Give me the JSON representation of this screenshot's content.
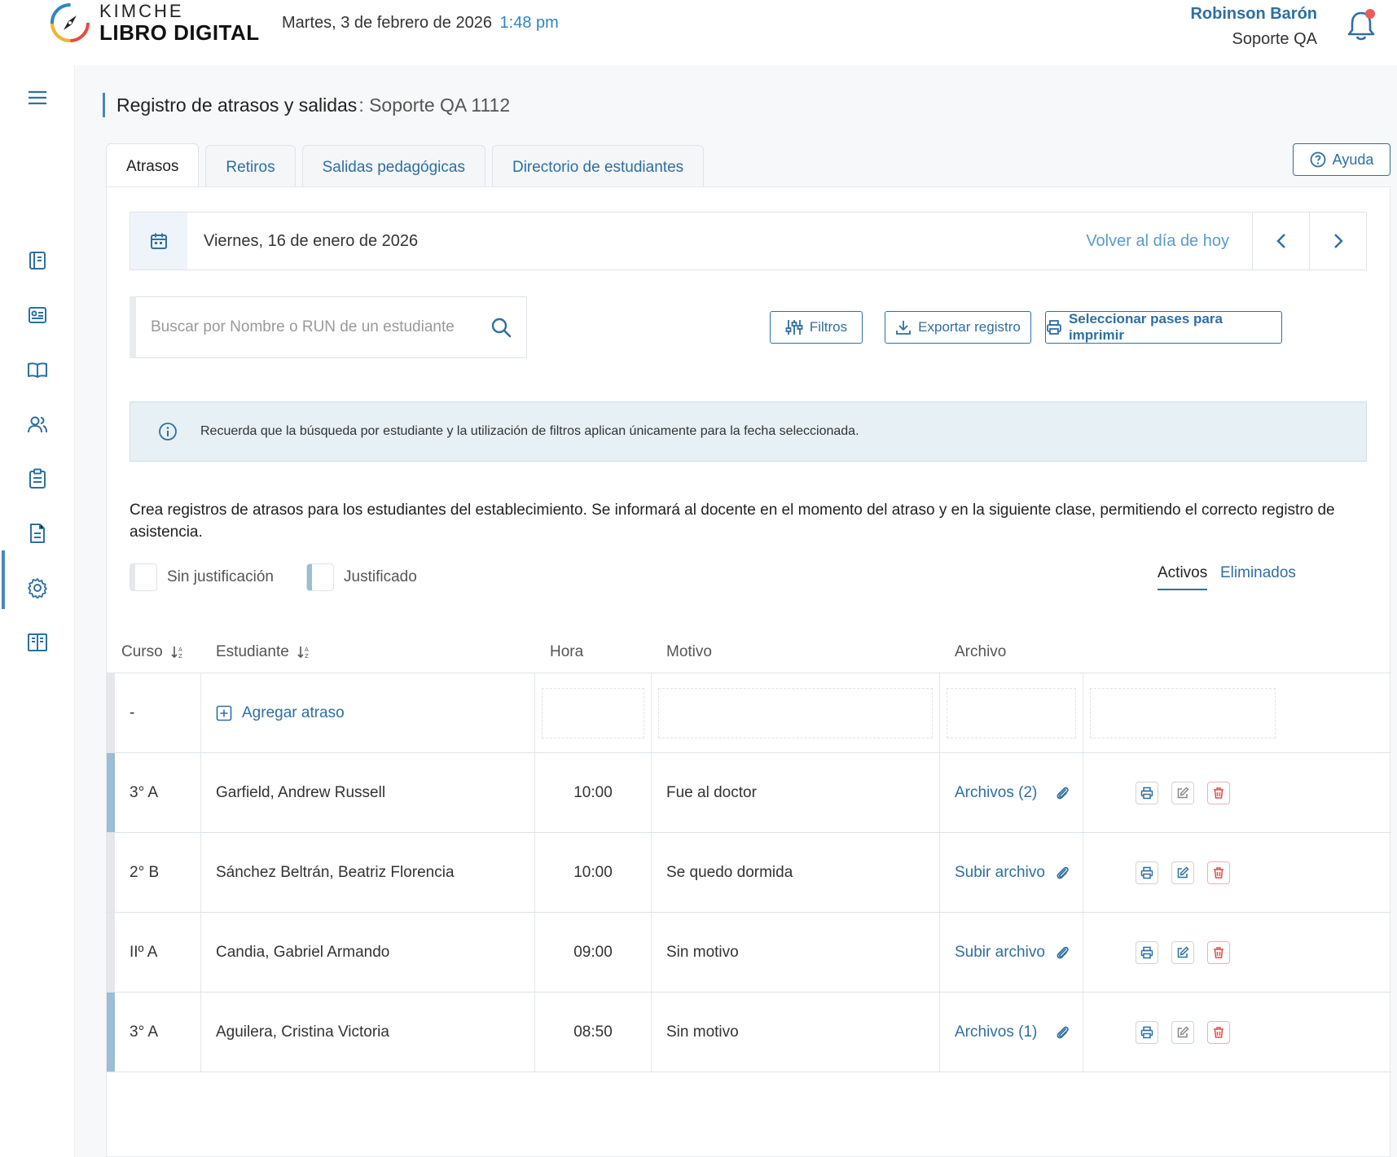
{
  "header": {
    "brand_top": "KIMCHE",
    "brand_bottom": "LIBRO DIGITAL",
    "date": "Martes, 3 de febrero de 2026",
    "time": "1:48 pm",
    "user_name": "Robinson Barón",
    "user_role": "Soporte QA"
  },
  "page": {
    "title": "Registro de atrasos y salidas",
    "subtitle": ": Soporte QA 1112"
  },
  "tabs": [
    {
      "label": "Atrasos",
      "active": true
    },
    {
      "label": "Retiros",
      "active": false
    },
    {
      "label": "Salidas pedagógicas",
      "active": false
    },
    {
      "label": "Directorio de estudiantes",
      "active": false
    }
  ],
  "help_label": "Ayuda",
  "datebar": {
    "date": "Viernes, 16 de enero de 2026",
    "today_link": "Volver al día de hoy"
  },
  "search": {
    "placeholder": "Buscar por Nombre o RUN de un estudiante"
  },
  "buttons": {
    "filters": "Filtros",
    "export": "Exportar registro",
    "print_passes": "Seleccionar pases para imprimir"
  },
  "info_text": "Recuerda que la búsqueda por estudiante y la utilización de filtros aplican únicamente para la fecha seleccionada.",
  "description": "Crea registros de atrasos para los estudiantes del establecimiento. Se informará al docente en el momento del atraso y en la siguiente clase, permitiendo el correcto registro de asistencia.",
  "legend": {
    "unjustified": "Sin justificación",
    "justified": "Justificado"
  },
  "view_toggle": {
    "active": "Activos",
    "deleted": "Eliminados"
  },
  "table": {
    "headers": {
      "curso": "Curso",
      "estudiante": "Estudiante",
      "hora": "Hora",
      "motivo": "Motivo",
      "archivo": "Archivo"
    },
    "add_row": {
      "curso": "-",
      "label": "Agregar atraso"
    },
    "rows": [
      {
        "curso": "3° A",
        "estudiante": "Garfield, Andrew Russell",
        "hora": "10:00",
        "motivo": "Fue al doctor",
        "archivo": "Archivos (2)",
        "justificado": true
      },
      {
        "curso": "2° B",
        "estudiante": "Sánchez Beltrán, Beatriz Florencia",
        "hora": "10:00",
        "motivo": "Se quedo dormida",
        "archivo": "Subir archivo",
        "justificado": false
      },
      {
        "curso": "IIº A",
        "estudiante": "Candia, Gabriel Armando",
        "hora": "09:00",
        "motivo": "Sin motivo",
        "archivo": "Subir archivo",
        "justificado": false
      },
      {
        "curso": "3° A",
        "estudiante": "Aguilera, Cristina Victoria",
        "hora": "08:50",
        "motivo": "Sin motivo",
        "archivo": "Archivos (1)",
        "justificado": true
      }
    ]
  },
  "colors": {
    "primary": "#2e6fa3",
    "justified_mark": "#9dbcd6",
    "unjustified_mark": "#e5e7ea",
    "danger": "#d9534f",
    "notification_dot": "#e85c5c"
  }
}
